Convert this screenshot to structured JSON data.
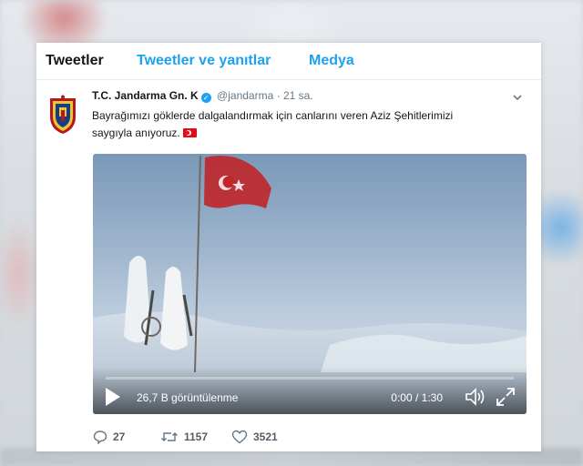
{
  "tabs": [
    {
      "label": "Tweetler",
      "active": true
    },
    {
      "label": "Tweetler ve yanıtlar",
      "active": false
    },
    {
      "label": "Medya",
      "active": false
    }
  ],
  "tweet": {
    "author_name": "T.C. Jandarma Gn. K",
    "handle": "@jandarma",
    "separator": "·",
    "time": "21 sa.",
    "text": "Bayrağımızı göklerde dalgalandırmak için canlarını veren Aziz Şehitlerimizi saygıyla anıyoruz.",
    "avatar_icon": "gendarmerie-emblem-icon",
    "verified_icon": "verified-badge-icon",
    "emoji": "turkish-flag-emoji"
  },
  "video": {
    "views": "26,7 B görüntülenme",
    "duration": "0:00 / 1:30",
    "progress": 0
  },
  "actions": {
    "replies": "27",
    "retweets": "1157",
    "likes": "3521"
  },
  "colors": {
    "accent": "#1da1f2",
    "text": "#14171a",
    "muted": "#657786"
  }
}
